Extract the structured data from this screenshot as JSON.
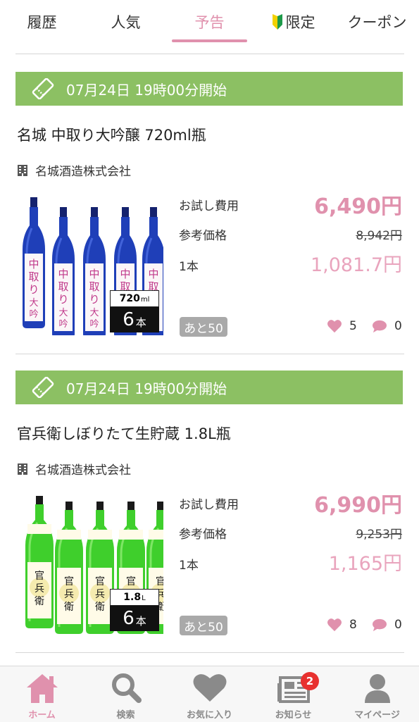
{
  "tabs": [
    {
      "label": "履歴"
    },
    {
      "label": "人気"
    },
    {
      "label": "予告"
    },
    {
      "label": "限定"
    },
    {
      "label": "クーポン"
    }
  ],
  "active_tab": "予告",
  "items": [
    {
      "start_time": "07月24日 19時00分開始",
      "title": "名城 中取り大吟醸 720ml瓶",
      "brewery": "名城酒造株式会社",
      "volume_num": "720",
      "volume_unit": "ml",
      "count_num": "6",
      "count_unit": "本",
      "trial_label": "お試し費用",
      "trial_price": "6,490円",
      "ref_label": "参考価格",
      "ref_price": "8,942円",
      "unit_label": "1本",
      "unit_price": "1,081.7円",
      "remaining": "あと50",
      "likes": "5",
      "comments": "0",
      "bottle_color": "#1f3fb8",
      "label_text": "中取り大吟醸"
    },
    {
      "start_time": "07月24日 19時00分開始",
      "title": "官兵衛しぼりたて生貯蔵 1.8L瓶",
      "brewery": "名城酒造株式会社",
      "volume_num": "1.8",
      "volume_unit": "L",
      "count_num": "6",
      "count_unit": "本",
      "trial_label": "お試し費用",
      "trial_price": "6,990円",
      "ref_label": "参考価格",
      "ref_price": "9,253円",
      "unit_label": "1本",
      "unit_price": "1,165円",
      "remaining": "あと50",
      "likes": "8",
      "comments": "0",
      "bottle_color": "#3fcf2c",
      "label_text": "官兵衛"
    }
  ],
  "bottom_nav": [
    {
      "label": "ホーム",
      "icon": "home-icon",
      "active": true
    },
    {
      "label": "検索",
      "icon": "search-icon"
    },
    {
      "label": "お気に入り",
      "icon": "heart-icon"
    },
    {
      "label": "お知らせ",
      "icon": "newspaper-icon",
      "badge": "2"
    },
    {
      "label": "マイページ",
      "icon": "person-icon"
    }
  ],
  "colors": {
    "accent": "#e091ad",
    "banner": "#8cc063",
    "badge": "#e8312f"
  }
}
